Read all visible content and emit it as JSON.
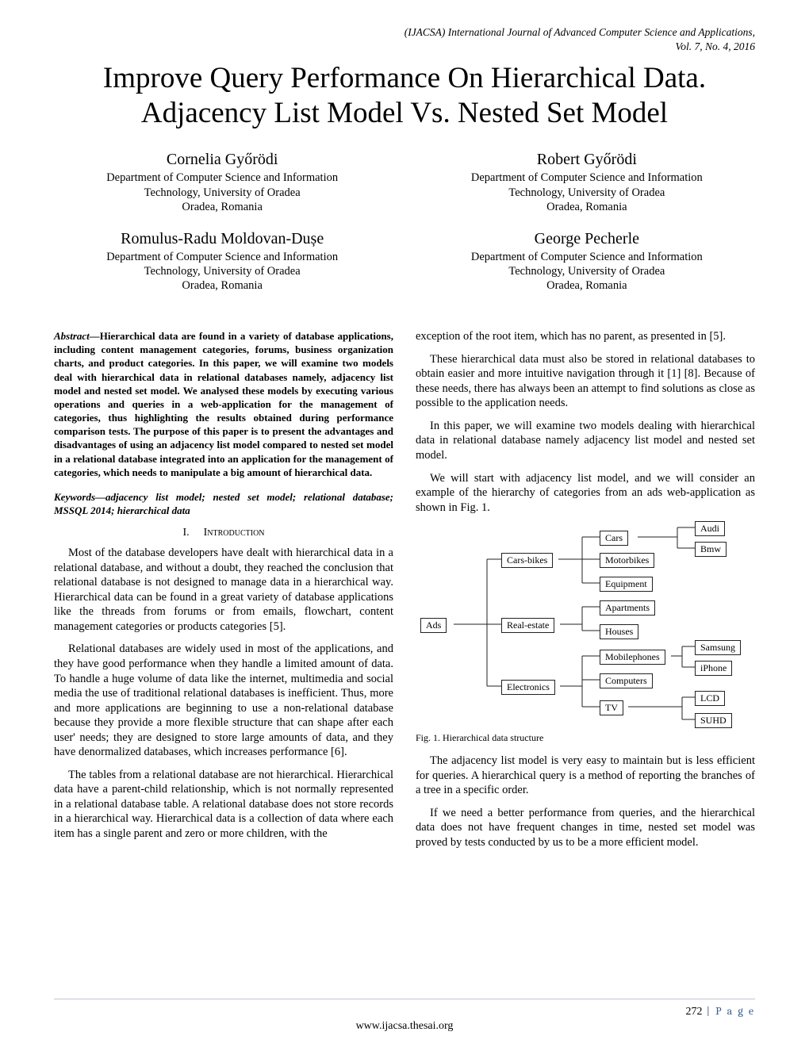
{
  "journal": {
    "line1": "(IJACSA) International Journal of Advanced Computer Science and Applications,",
    "line2": "Vol. 7, No. 4, 2016"
  },
  "title": "Improve Query Performance On Hierarchical Data. Adjacency List Model Vs. Nested Set Model",
  "authors": [
    {
      "name": "Cornelia Győrödi",
      "aff1": "Department of Computer Science and Information",
      "aff2": "Technology, University of Oradea",
      "aff3": "Oradea, Romania"
    },
    {
      "name": "Robert Győrödi",
      "aff1": "Department of Computer Science and Information",
      "aff2": "Technology, University of Oradea",
      "aff3": "Oradea, Romania"
    },
    {
      "name": "Romulus-Radu Moldovan-Dușe",
      "aff1": "Department of Computer Science and Information",
      "aff2": "Technology, University of Oradea",
      "aff3": "Oradea, Romania"
    },
    {
      "name": "George Pecherle",
      "aff1": "Department of Computer Science and Information",
      "aff2": "Technology, University of Oradea",
      "aff3": "Oradea, Romania"
    }
  ],
  "abstract": {
    "label": "Abstract—",
    "text": "Hierarchical data are found in a variety of database applications, including content management categories, forums, business organization charts, and product categories. In this paper, we will examine two models deal with hierarchical data in relational databases namely, adjacency list model and nested set model. We analysed these models by executing various operations and queries in a web-application for the management of categories, thus highlighting the results obtained during performance comparison tests. The purpose of this paper is to present the advantages and disadvantages of using an adjacency list model compared to nested set model in a relational database integrated into an application for the management of categories, which needs to manipulate a big amount of hierarchical data."
  },
  "keywords": {
    "label": "Keywords—",
    "text": "adjacency list model; nested set model; relational database; MSSQL 2014; hierarchical data"
  },
  "section1": {
    "num": "I.",
    "title": "Introduction"
  },
  "paras": {
    "l1": "Most of the database developers have dealt with hierarchical data in a relational database, and without a doubt, they reached the conclusion that relational database is not designed to manage data in a hierarchical way. Hierarchical data can be found in a great variety of database applications like the threads from forums or from emails, flowchart, content management categories or products categories [5].",
    "l2": "Relational databases are widely used in most of the applications, and they have good performance when they handle a limited amount of data. To handle a huge volume of data like the internet, multimedia and social media the use of traditional relational databases is inefficient. Thus, more and more applications are beginning to use a non-relational database because they provide a more flexible structure that can shape after each user' needs; they are designed to store large amounts of data, and they have denormalized databases, which increases performance [6].",
    "l3": "The tables from a relational database are not hierarchical. Hierarchical data have a parent-child relationship, which is not normally represented in a relational database table. A relational database does not store records in a hierarchical way. Hierarchical data is a collection of data where each item has a single parent and zero or more children, with the",
    "r1": "exception of the root item, which has no parent, as presented in [5].",
    "r2": "These hierarchical data must also be stored in relational databases to obtain easier and more intuitive navigation through it [1] [8]. Because of these needs, there has always been an attempt to find solutions as close as possible to the application needs.",
    "r3": "In this paper, we will examine two models dealing with hierarchical data in relational database namely adjacency list model and nested set model.",
    "r4": "We will start with adjacency list model, and we will consider an example of the hierarchy of categories from an ads web-application as shown in Fig. 1.",
    "r5": "The adjacency list model is very easy to maintain but is less efficient for queries. A hierarchical query is a method of reporting the branches of a tree in a specific order.",
    "r6": "If we need a better performance from queries, and the hierarchical data does not have frequent changes in time, nested set model was proved by tests conducted by us to be a more efficient model."
  },
  "figcaption": "Fig. 1.    Hierarchical data structure",
  "nodes": {
    "ads": "Ads",
    "carsbikes": "Cars-bikes",
    "realestate": "Real-estate",
    "electronics": "Electronics",
    "cars": "Cars",
    "motorbikes": "Motorbikes",
    "equipment": "Equipment",
    "apartments": "Apartments",
    "houses": "Houses",
    "mobilephones": "Mobilephones",
    "computers": "Computers",
    "tv": "TV",
    "audi": "Audi",
    "bmw": "Bmw",
    "samsung": "Samsung",
    "iphone": "iPhone",
    "lcd": "LCD",
    "suhd": "SUHD"
  },
  "footer": {
    "pagenum": "272",
    "pagelabel": " | P a g e",
    "url": "www.ijacsa.thesai.org"
  },
  "chart_data": {
    "type": "tree",
    "title": "Hierarchical data structure",
    "root": {
      "name": "Ads",
      "children": [
        {
          "name": "Cars-bikes",
          "children": [
            {
              "name": "Cars",
              "children": [
                {
                  "name": "Audi"
                },
                {
                  "name": "Bmw"
                }
              ]
            },
            {
              "name": "Motorbikes"
            },
            {
              "name": "Equipment"
            }
          ]
        },
        {
          "name": "Real-estate",
          "children": [
            {
              "name": "Apartments"
            },
            {
              "name": "Houses"
            }
          ]
        },
        {
          "name": "Electronics",
          "children": [
            {
              "name": "Mobilephones",
              "children": [
                {
                  "name": "Samsung"
                },
                {
                  "name": "iPhone"
                }
              ]
            },
            {
              "name": "Computers"
            },
            {
              "name": "TV",
              "children": [
                {
                  "name": "LCD"
                },
                {
                  "name": "SUHD"
                }
              ]
            }
          ]
        }
      ]
    }
  }
}
